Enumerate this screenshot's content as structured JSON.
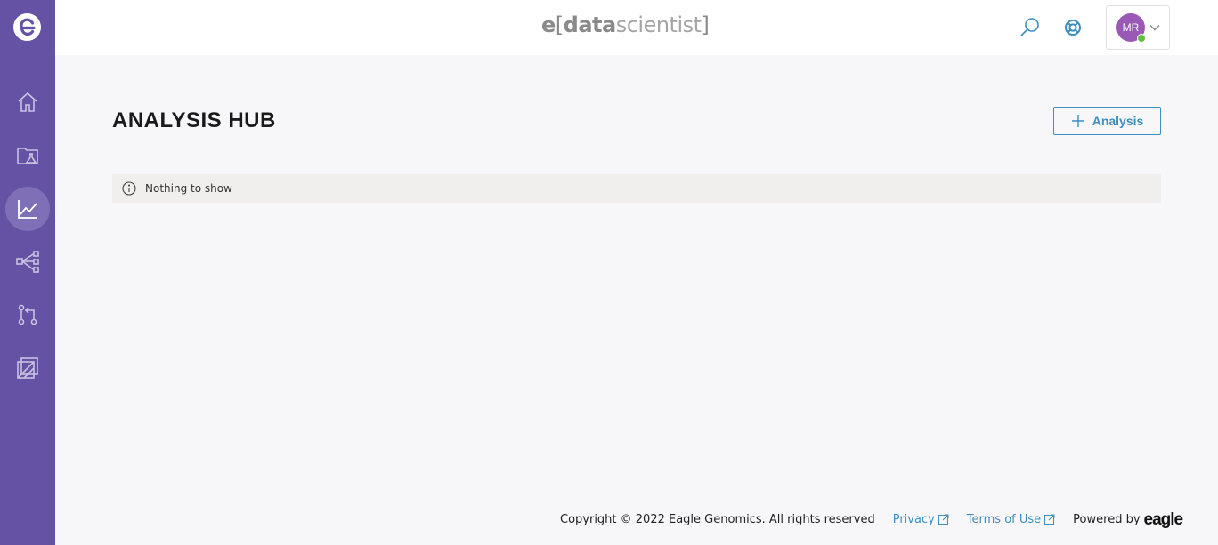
{
  "brand": {
    "e": "e",
    "open": "[",
    "data": "data",
    "scientist": "scientist",
    "close": "]"
  },
  "sidebar": {
    "logo_icon": "eagle-e-logo",
    "items": [
      {
        "icon": "home-icon",
        "active": false
      },
      {
        "icon": "folder-flask-icon",
        "active": false
      },
      {
        "icon": "line-chart-icon",
        "active": true
      },
      {
        "icon": "network-share-icon",
        "active": false
      },
      {
        "icon": "pull-request-icon",
        "active": false
      },
      {
        "icon": "layers-icon",
        "active": false
      }
    ]
  },
  "header": {
    "search_icon": "search-icon",
    "help_icon": "lifebuoy-icon",
    "user": {
      "initials": "MR",
      "status_color": "#5fbf3f"
    }
  },
  "main": {
    "title": "ANALYSIS HUB",
    "add_button_label": "Analysis",
    "empty_message": "Nothing to show"
  },
  "footer": {
    "copyright": "Copyright © 2022 Eagle Genomics. All rights reserved",
    "privacy": "Privacy",
    "terms": "Terms of Use",
    "powered_by": "Powered by",
    "powered_logo": "eagle"
  },
  "colors": {
    "sidebar": "#6552a4",
    "sidebar_active": "#7f6fb6",
    "accent": "#3c8fbf",
    "avatar": "#9b59b6"
  }
}
